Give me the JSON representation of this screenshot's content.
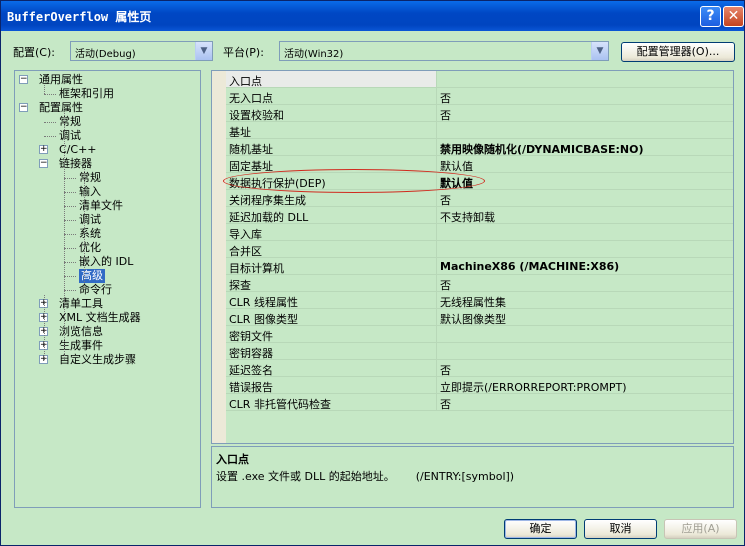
{
  "window": {
    "title": "BufferOverflow 属性页"
  },
  "titlebar_buttons": {
    "help": "?",
    "close": "✕"
  },
  "config_bar": {
    "config_label": "配置(C):",
    "config_value": "活动(Debug)",
    "platform_label": "平台(P):",
    "platform_value": "活动(Win32)",
    "config_manager_label": "配置管理器(O)..."
  },
  "tree": {
    "expand_collapsed": "+",
    "expand_open": "−",
    "items": [
      {
        "label": "通用属性",
        "expander": "open"
      },
      {
        "label": "框架和引用"
      },
      {
        "label": "配置属性",
        "expander": "open"
      },
      {
        "label": "常规"
      },
      {
        "label": "调试"
      },
      {
        "label": "C/C++",
        "expander": "collapsed"
      },
      {
        "label": "链接器",
        "expander": "open"
      },
      {
        "label": "常规"
      },
      {
        "label": "输入"
      },
      {
        "label": "清单文件"
      },
      {
        "label": "调试"
      },
      {
        "label": "系统"
      },
      {
        "label": "优化"
      },
      {
        "label": "嵌入的 IDL"
      },
      {
        "label": "高级",
        "selected": true
      },
      {
        "label": "命令行"
      },
      {
        "label": "清单工具",
        "expander": "collapsed"
      },
      {
        "label": "XML 文档生成器",
        "expander": "collapsed"
      },
      {
        "label": "浏览信息",
        "expander": "collapsed"
      },
      {
        "label": "生成事件",
        "expander": "collapsed"
      },
      {
        "label": "自定义生成步骤",
        "expander": "collapsed"
      }
    ]
  },
  "grid": {
    "rows": [
      {
        "name": "入口点",
        "value": ""
      },
      {
        "name": "无入口点",
        "value": "否"
      },
      {
        "name": "设置校验和",
        "value": "否"
      },
      {
        "name": "基址",
        "value": ""
      },
      {
        "name": "随机基址",
        "value": "禁用映像随机化(/DYNAMICBASE:NO)",
        "bold": true
      },
      {
        "name": "固定基址",
        "value": "默认值"
      },
      {
        "name": "数据执行保护(DEP)",
        "value": "默认值",
        "bold": true
      },
      {
        "name": "关闭程序集生成",
        "value": "否"
      },
      {
        "name": "延迟加载的 DLL",
        "value": "不支持卸载"
      },
      {
        "name": "导入库",
        "value": ""
      },
      {
        "name": "合并区",
        "value": ""
      },
      {
        "name": "目标计算机",
        "value": "MachineX86 (/MACHINE:X86)",
        "bold": true
      },
      {
        "name": "探查",
        "value": "否"
      },
      {
        "name": "CLR 线程属性",
        "value": "无线程属性集"
      },
      {
        "name": "CLR 图像类型",
        "value": "默认图像类型"
      },
      {
        "name": "密钥文件",
        "value": ""
      },
      {
        "name": "密钥容器",
        "value": ""
      },
      {
        "name": "延迟签名",
        "value": "否"
      },
      {
        "name": "错误报告",
        "value": "立即提示(/ERRORREPORT:PROMPT)"
      },
      {
        "name": "CLR 非托管代码检查",
        "value": "否"
      }
    ]
  },
  "description": {
    "title": "入口点",
    "text": "设置 .exe 文件或 DLL 的起始地址。      (/ENTRY:[symbol])"
  },
  "buttons": {
    "ok": "确定",
    "cancel": "取消",
    "apply": "应用(A)"
  },
  "colors": {
    "window_bg": "#c6e8c6",
    "titlebar": "#0047c4",
    "selection": "#316ac5",
    "highlight_ellipse": "#d02a1e"
  }
}
